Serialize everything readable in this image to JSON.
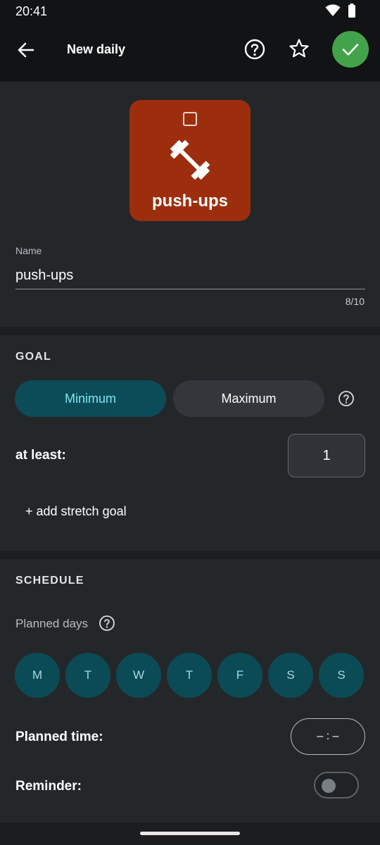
{
  "status_bar": {
    "time": "20:41",
    "icons": [
      "wifi-icon",
      "battery-icon"
    ]
  },
  "app_bar": {
    "title": "New daily",
    "icons": [
      "back-arrow-icon",
      "help-icon",
      "star-icon",
      "check-icon"
    ],
    "confirm_color": "#43a34a"
  },
  "habit_tile": {
    "label": "push-ups",
    "color": "#9c2e0e",
    "icon": "dumbbell-icon"
  },
  "name_field": {
    "label": "Name",
    "value": "push-ups",
    "counter": "8/10"
  },
  "goal": {
    "section_title": "GOAL",
    "options": [
      "Minimum",
      "Maximum"
    ],
    "selected": "Minimum",
    "amount_label": "at least:",
    "amount_value": "1",
    "stretch_link": "+ add stretch goal"
  },
  "schedule": {
    "section_title": "SCHEDULE",
    "planned_days_label": "Planned days",
    "days": [
      "M",
      "T",
      "W",
      "T",
      "F",
      "S",
      "S"
    ],
    "planned_time_label": "Planned time:",
    "planned_time_value": "– : –",
    "reminder_label": "Reminder:",
    "reminder_on": false
  },
  "colors": {
    "accent": "#0c4b58",
    "accent_text": "#7ee7ef",
    "background": "#1b1d1f",
    "card": "#24272a"
  }
}
